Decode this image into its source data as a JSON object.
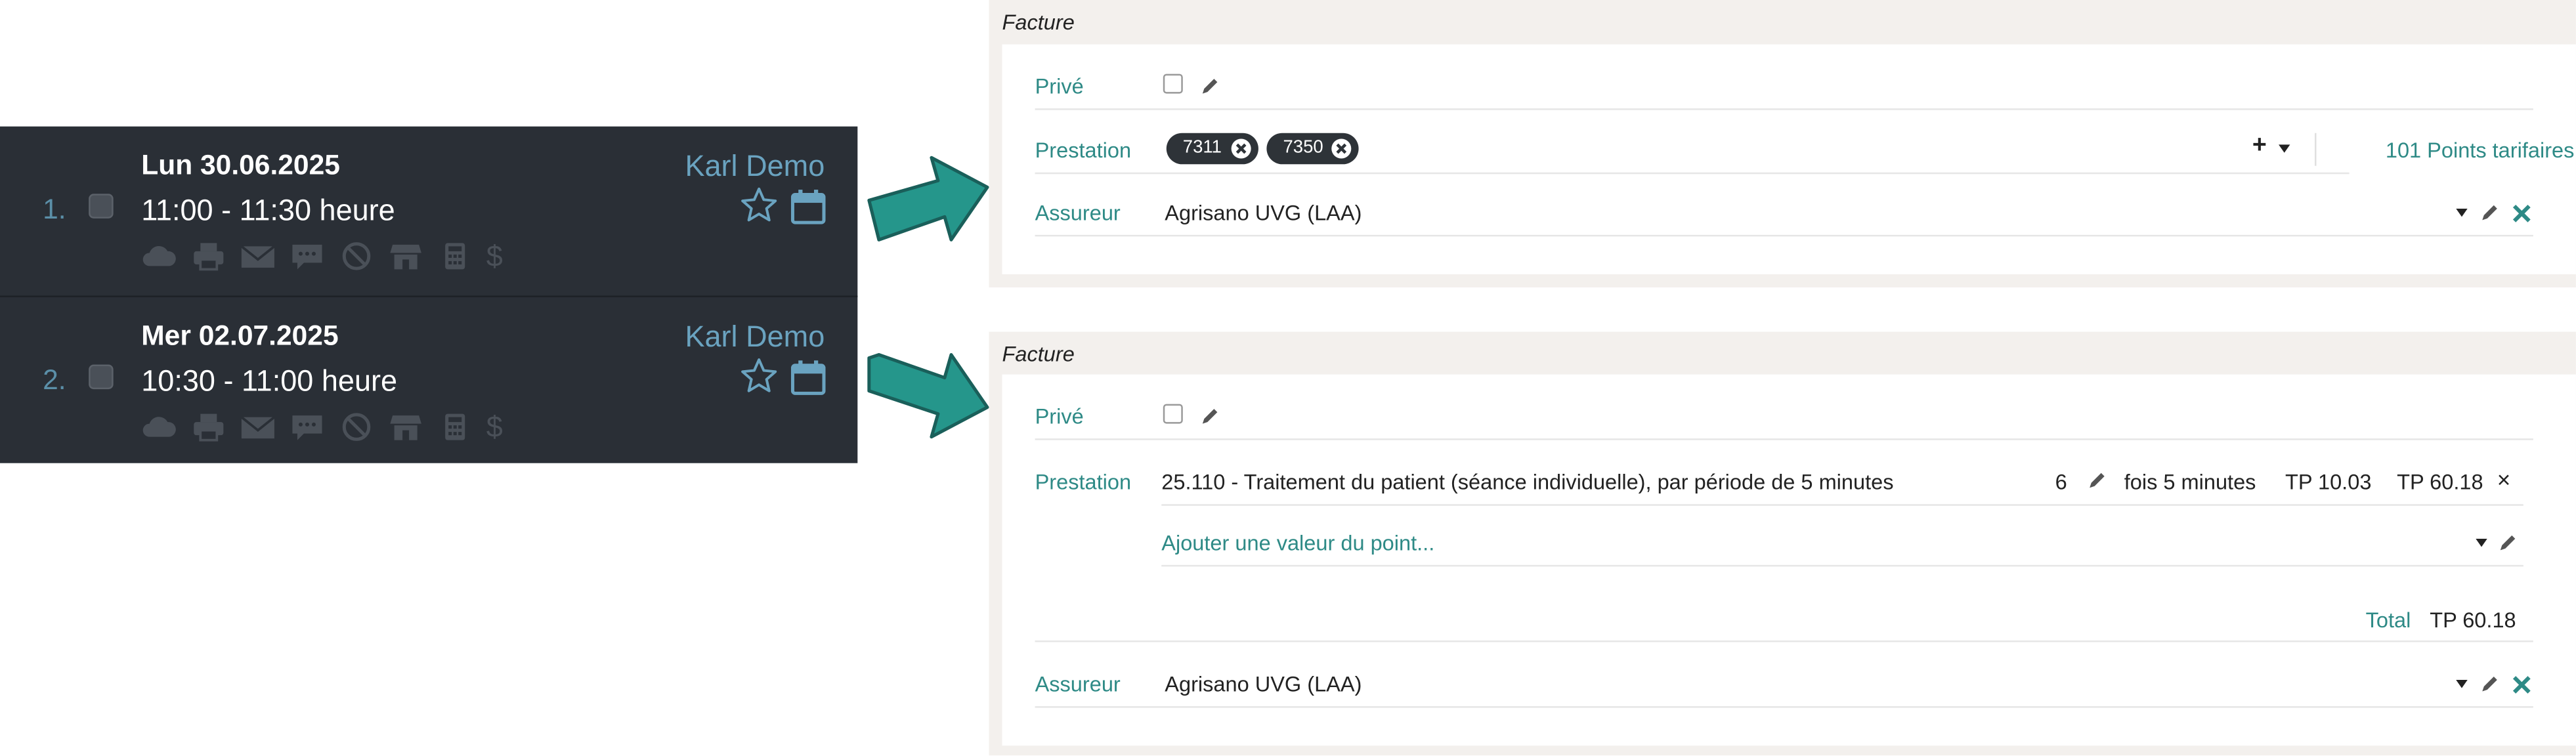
{
  "appointments": [
    {
      "index": "1.",
      "date": "Lun 30.06.2025",
      "time": "11:00 - 11:30 heure",
      "person": "Karl Demo",
      "icons": [
        "cloud-icon",
        "printer-icon",
        "envelope-icon",
        "sms-icon",
        "no-show-icon",
        "shop-icon",
        "calculator-icon",
        "dollar-icon"
      ],
      "dollar_glyph": "$"
    },
    {
      "index": "2.",
      "date": "Mer 02.07.2025",
      "time": "10:30 - 11:00 heure",
      "person": "Karl Demo",
      "icons": [
        "cloud-icon",
        "printer-icon",
        "envelope-icon",
        "sms-icon",
        "no-show-icon",
        "shop-icon",
        "calculator-icon",
        "dollar-icon"
      ],
      "dollar_glyph": "$"
    }
  ],
  "invoice1": {
    "title": "Facture",
    "prive_label": "Privé",
    "prestation_label": "Prestation",
    "chips": [
      "7311",
      "7350"
    ],
    "add_glyph": "+",
    "points": "101 Points tarifaires",
    "assureur_label": "Assureur",
    "assureur_value": "Agrisano UVG (LAA)"
  },
  "invoice2": {
    "title": "Facture",
    "prive_label": "Privé",
    "prestation_label": "Prestation",
    "service_text": "25.110 - Traitement du patient (séance individuelle), par période de 5 minutes",
    "quantity": "6",
    "unit": "fois 5 minutes",
    "unit_price": "TP 10.03",
    "line_total": "TP 60.18",
    "remove_glyph": "×",
    "add_point_value": "Ajouter une valeur du point...",
    "total_label": "Total",
    "total_value": "TP 60.18",
    "assureur_label": "Assureur",
    "assureur_value": "Agrisano UVG (LAA)"
  },
  "colors": {
    "teal": "#2e8a86",
    "dark_bg": "#2a2f36",
    "arrow": "#25968b",
    "panel_bg": "#f3f0ed"
  }
}
